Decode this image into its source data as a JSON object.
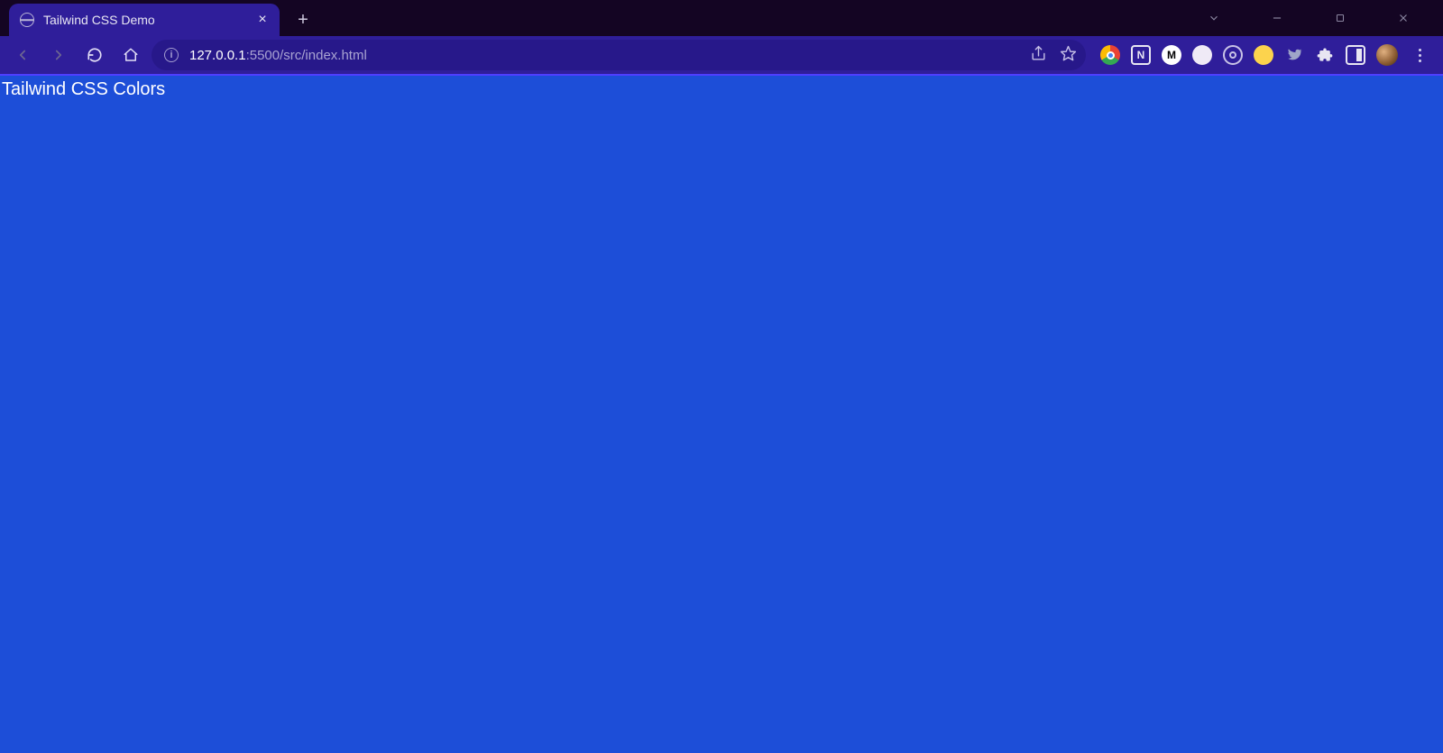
{
  "tab": {
    "title": "Tailwind CSS Demo"
  },
  "address": {
    "host": "127.0.0.1",
    "rest": ":5500/src/index.html"
  },
  "page": {
    "heading": "Tailwind CSS Colors"
  },
  "icons": {
    "back": "back-icon",
    "forward": "forward-icon",
    "reload": "reload-icon",
    "home": "home-icon",
    "info": "site-info-icon",
    "share": "share-icon",
    "star": "bookmark-star-icon",
    "tabsearch": "tab-search-icon",
    "minimize": "minimize-icon",
    "maximize": "maximize-icon",
    "closewin": "close-window-icon",
    "newtab": "new-tab-icon",
    "closetab": "close-tab-icon",
    "puzzle": "extensions-icon",
    "panel": "side-panel-icon",
    "menu": "browser-menu-icon"
  }
}
